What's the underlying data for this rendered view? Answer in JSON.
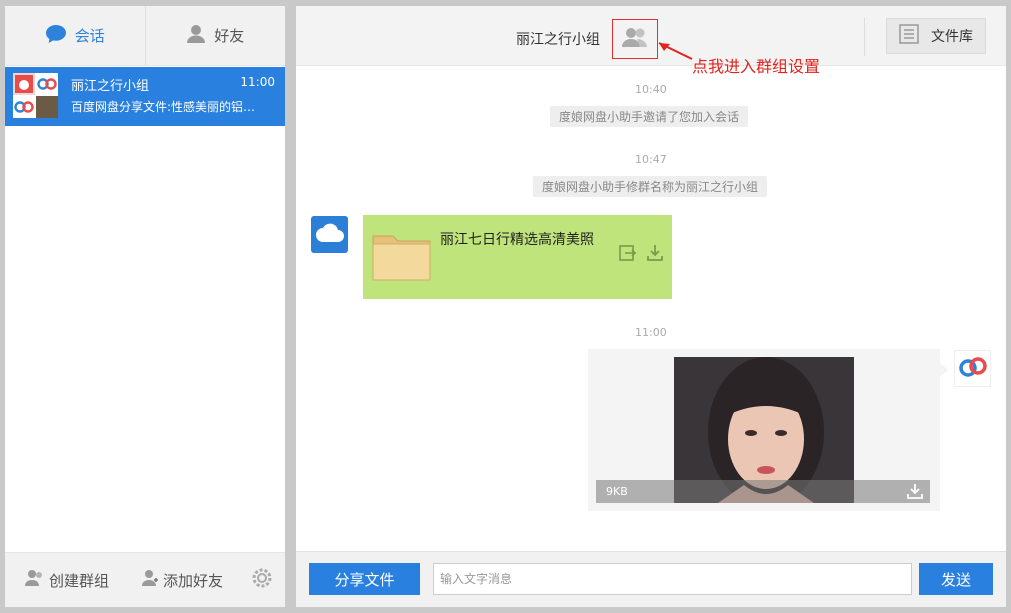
{
  "sidebar": {
    "tabs": [
      {
        "label": "会话",
        "icon": "chat-bubble-icon",
        "active": true
      },
      {
        "label": "好友",
        "icon": "person-icon",
        "active": false
      }
    ],
    "conversation": {
      "name": "丽江之行小组",
      "time": "11:00",
      "preview": "百度网盘分享文件:性感美丽的铝…"
    },
    "bottom": {
      "create_group": "创建群组",
      "add_friend": "添加好友"
    }
  },
  "chat": {
    "header": {
      "title": "丽江之行小组",
      "hint": "点我进入群组设置",
      "file_library": "文件库"
    },
    "events": [
      {
        "time": "10:40",
        "text": "度娘网盘小助手邀请了您加入会话"
      },
      {
        "time": "10:47",
        "text": "度娘网盘小助手修群名称为丽江之行小组"
      }
    ],
    "file_message": {
      "title": "丽江七日行精选高清美照"
    },
    "image_message": {
      "time": "11:00",
      "size": "9KB"
    },
    "composer": {
      "share_label": "分享文件",
      "placeholder": "输入文字消息",
      "send_label": "发送"
    }
  },
  "colors": {
    "accent": "#2a80de",
    "bubble_green": "#bfe47b",
    "hint_red": "#e3231e"
  }
}
